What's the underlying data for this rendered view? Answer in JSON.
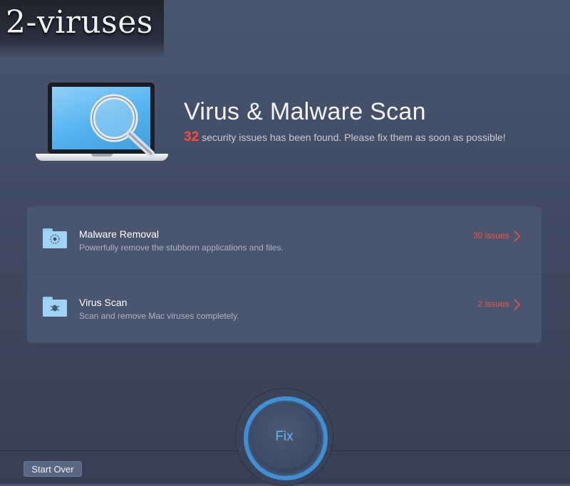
{
  "watermark": "2-viruses",
  "header": {
    "title": "Virus & Malware Scan",
    "issue_count": "32",
    "message": "security issues has been found. Please fix them as soon as possible!"
  },
  "scan_items": [
    {
      "name": "Malware Removal",
      "description": "Powerfully remove the stubborn applications and files.",
      "issues": "30 issues",
      "icon": "folder-malware-icon"
    },
    {
      "name": "Virus Scan",
      "description": "Scan and remove Mac viruses completely.",
      "issues": "2 issues",
      "icon": "folder-bug-icon"
    }
  ],
  "fix_button": "Fix",
  "start_over_button": "Start Over",
  "colors": {
    "accent_red": "#ff4a3d",
    "accent_blue": "#3d8fd6",
    "background": "#434e67"
  }
}
